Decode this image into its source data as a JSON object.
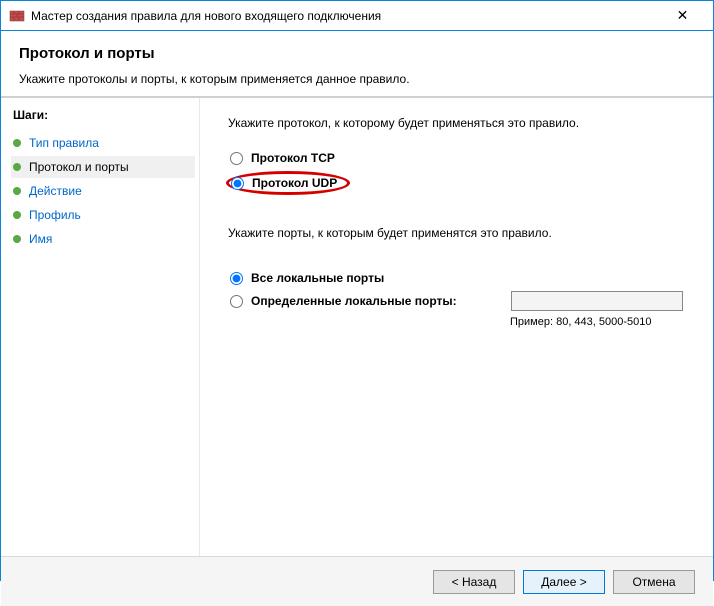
{
  "titlebar": {
    "title": "Мастер создания правила для нового входящего подключения",
    "close": "✕"
  },
  "header": {
    "title": "Протокол и порты",
    "subtitle": "Укажите протоколы и порты, к которым применяется данное правило."
  },
  "sidebar": {
    "heading": "Шаги:",
    "steps": [
      {
        "label": "Тип правила"
      },
      {
        "label": "Протокол и порты"
      },
      {
        "label": "Действие"
      },
      {
        "label": "Профиль"
      },
      {
        "label": "Имя"
      }
    ]
  },
  "main": {
    "protocol_prompt": "Укажите протокол, к которому будет применяться это правило.",
    "protocol_tcp": "Протокол TCP",
    "protocol_udp": "Протокол UDP",
    "ports_prompt": "Укажите порты, к которым будет применятся это правило.",
    "ports_all": "Все локальные порты",
    "ports_specific": "Определенные локальные порты:",
    "ports_input_value": "",
    "example": "Пример: 80, 443, 5000-5010"
  },
  "footer": {
    "back": "< Назад",
    "next": "Далее >",
    "cancel": "Отмена"
  }
}
